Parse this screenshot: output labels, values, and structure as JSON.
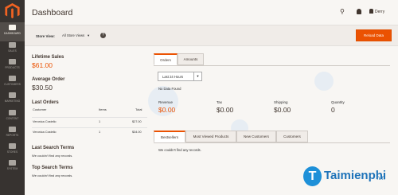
{
  "sidebar": {
    "items": [
      {
        "label": "DASHBOARD",
        "active": true
      },
      {
        "label": "SALES",
        "active": false
      },
      {
        "label": "PRODUCTS",
        "active": false
      },
      {
        "label": "CUSTOMERS",
        "active": false
      },
      {
        "label": "MARKETING",
        "active": false
      },
      {
        "label": "CONTENT",
        "active": false
      },
      {
        "label": "REPORTS",
        "active": false
      },
      {
        "label": "STORES",
        "active": false
      },
      {
        "label": "SYSTEM",
        "active": false
      }
    ]
  },
  "header": {
    "title": "Dashboard",
    "user_name": "Derry"
  },
  "store_bar": {
    "label": "Store View:",
    "selected": "All Store Views",
    "reload_button": "Reload Data"
  },
  "left": {
    "lifetime_sales_label": "Lifetime Sales",
    "lifetime_sales_value": "$61.00",
    "average_order_label": "Average Order",
    "average_order_value": "$30.50",
    "last_orders_label": "Last Orders",
    "columns": [
      "Customer",
      "Items",
      "Total"
    ],
    "rows": [
      [
        "Veronica Costello",
        "1",
        "$27.00"
      ],
      [
        "Veronica Costello",
        "1",
        "$34.00"
      ]
    ],
    "last_search_label": "Last Search Terms",
    "last_search_empty": "We couldn't find any records.",
    "top_search_label": "Top Search Terms",
    "top_search_empty": "We couldn't find any records."
  },
  "chart_tabs": {
    "orders": "Orders",
    "amounts": "Amounts"
  },
  "range": {
    "selected": "Last 24 Hours"
  },
  "no_data": "No Data Found",
  "metrics": [
    {
      "label": "Revenue",
      "value": "$0.00",
      "color": "#eb5202"
    },
    {
      "label": "Tax",
      "value": "$0.00",
      "color": "#41362f"
    },
    {
      "label": "Shipping",
      "value": "$0.00",
      "color": "#41362f"
    },
    {
      "label": "Quantity",
      "value": "0",
      "color": "#41362f"
    }
  ],
  "grid_tabs": [
    "Bestsellers",
    "Most Viewed Products",
    "New Customers",
    "Customers"
  ],
  "grid_empty": "We couldn't find any records.",
  "watermark": {
    "brand": "Taimienphi",
    "brand_suffix": ".vn"
  },
  "colors": {
    "accent": "#eb5202",
    "sidebar_bg": "#373330"
  }
}
